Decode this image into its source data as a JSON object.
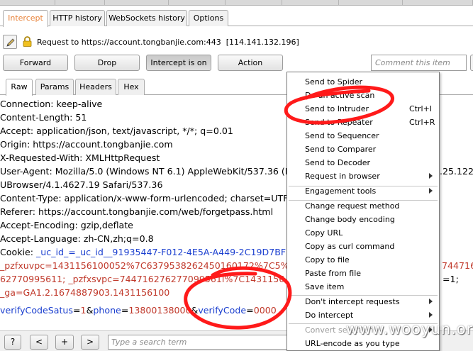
{
  "top_tabs": [
    "Intercept",
    "HTTP history",
    "WebSockets history",
    "Options"
  ],
  "request_label": "Request to https://account.tongbanjie.com:443",
  "request_ip": "[114.141.132.196]",
  "buttons": {
    "forward": "Forward",
    "drop": "Drop",
    "intercept": "Intercept is on",
    "action": "Action"
  },
  "comment_placeholder": "Comment this item",
  "sub_tabs": [
    "Raw",
    "Params",
    "Headers",
    "Hex"
  ],
  "editor_lines": [
    "Connection: keep-alive",
    "Content-Length: 51",
    "Accept: application/json, text/javascript, */*; q=0.01",
    "Origin: https://account.tongbanjie.com",
    "X-Requested-With: XMLHttpRequest",
    "User-Agent: Mozilla/5.0 (Windows NT 6.1) AppleWebKit/537.36 (K",
    "UBrowser/4.1.4627.19 Safari/537.36",
    "Content-Type: application/x-www-form-urlencoded; charset=UTF",
    "Referer: https://account.tongbanjie.com/web/forgetpass.html",
    "Accept-Encoding: gzip,deflate",
    "Accept-Language: zh-CN,zh;q=0.8"
  ],
  "ua_tail": ".25.122",
  "cookie": {
    "label": "Cookie: ",
    "line1": "_uc_id_=_uc_id__91935447-F012-4E5A-A449-2C19D7BF",
    "line2": "_pzfxuvpc=1431156100052%7C6379538262450160172%7C5%",
    "line2_tail": "744716",
    "line3": "62770995611; _pzfxsvpc=744716276277099561l%7C1431156",
    "line3_tail": "=1;",
    "line4": "_ga=GA1.2.1674887903.1431156100"
  },
  "body_params": {
    "k1": "verifyCodeSatus",
    "v1": "1",
    "amp1": "&",
    "k2": "phone",
    "v2": "13800138000",
    "amp2": "&",
    "k3": "verifyCode",
    "v3": "0000",
    "eq": "="
  },
  "context_menu": {
    "items": [
      {
        "label": "Send to Spider",
        "shortcut": "",
        "submenu": false
      },
      {
        "label": "Do an active scan",
        "shortcut": "",
        "submenu": false
      },
      {
        "label": "Send to Intruder",
        "shortcut": "Ctrl+I",
        "submenu": false
      },
      {
        "label": "Send to Repeater",
        "shortcut": "Ctrl+R",
        "submenu": false
      },
      {
        "label": "Send to Sequencer",
        "shortcut": "",
        "submenu": false
      },
      {
        "label": "Send to Comparer",
        "shortcut": "",
        "submenu": false
      },
      {
        "label": "Send to Decoder",
        "shortcut": "",
        "submenu": false
      },
      {
        "label": "Request in browser",
        "shortcut": "",
        "submenu": true
      },
      {
        "label": "Engagement tools",
        "shortcut": "",
        "submenu": true
      },
      {
        "label": "Change request method",
        "shortcut": "",
        "submenu": false
      },
      {
        "label": "Change body encoding",
        "shortcut": "",
        "submenu": false
      },
      {
        "label": "Copy URL",
        "shortcut": "",
        "submenu": false
      },
      {
        "label": "Copy as curl command",
        "shortcut": "",
        "submenu": false
      },
      {
        "label": "Copy to file",
        "shortcut": "",
        "submenu": false
      },
      {
        "label": "Paste from file",
        "shortcut": "",
        "submenu": false
      },
      {
        "label": "Save item",
        "shortcut": "",
        "submenu": false
      },
      {
        "label": "Don't intercept requests",
        "shortcut": "",
        "submenu": true
      },
      {
        "label": "Do intercept",
        "shortcut": "",
        "submenu": true
      },
      {
        "label": "Convert selection",
        "shortcut": "",
        "submenu": true
      },
      {
        "label": "URL-encode as you type",
        "shortcut": "",
        "submenu": false
      }
    ]
  },
  "bottom": {
    "help": "?",
    "prev": "<",
    "add": "+",
    "next": ">",
    "search_placeholder": "Type a search term"
  },
  "watermark": "www.wooyun.org",
  "colors": {
    "active_tab_text": "#e8833a",
    "param_red": "#c0392b",
    "param_blue": "#1b3fcf",
    "annotation_red": "#ff1a1a"
  }
}
